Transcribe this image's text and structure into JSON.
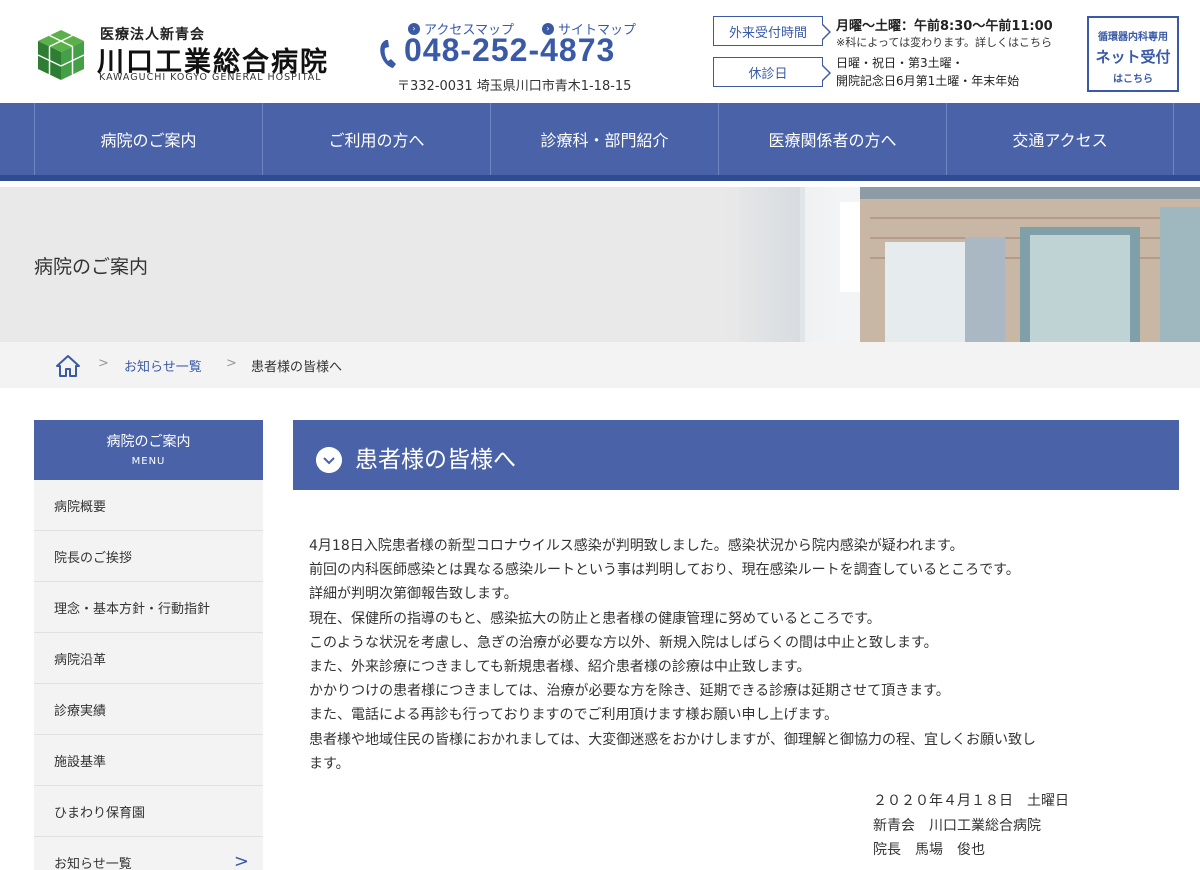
{
  "header": {
    "org": "医療法人新青会",
    "name": "川口工業総合病院",
    "name_en": "KAWAGUCHI KOGYO GENERAL HOSPITAL",
    "access_map": "アクセスマップ",
    "site_map": "サイトマップ",
    "phone": "048-252-4873",
    "address": "〒332-0031 埼玉県川口市青木1-18-15",
    "hours_label": "外来受付時間",
    "hours_main": "月曜～土曜：午前8:30～午前11:00",
    "hours_note": "※科によっては変わります。詳しくはこちら",
    "closed_label": "休診日",
    "closed_1": "日曜・祝日・第3土曜・",
    "closed_2": "開院記念日6月第1土曜・年末年始",
    "net_1": "循環器内科専用",
    "net_2": "ネット受付",
    "net_3": "はこちら"
  },
  "nav": [
    "病院のご案内",
    "ご利用の方へ",
    "診療科・部門紹介",
    "医療関係者の方へ",
    "交通アクセス"
  ],
  "hero": {
    "title": "病院のご案内"
  },
  "breadcrumb": {
    "sep": ">",
    "link": "お知らせ一覧",
    "current": "患者様の皆様へ"
  },
  "side": {
    "title": "病院のご案内",
    "subtitle": "MENU",
    "items": [
      "病院概要",
      "院長のご挨拶",
      "理念・基本方針・行動指針",
      "病院沿革",
      "診療実績",
      "施設基準",
      "ひまわり保育園",
      "お知らせ一覧"
    ],
    "chevron": ">"
  },
  "main": {
    "title": "患者様の皆様へ",
    "lines": [
      "4月18日入院患者様の新型コロナウイルス感染が判明致しました。感染状況から院内感染が疑われます。",
      "前回の内科医師感染とは異なる感染ルートという事は判明しており、現在感染ルートを調査しているところです。",
      "詳細が判明次第御報告致します。",
      "現在、保健所の指導のもと、感染拡大の防止と患者様の健康管理に努めているところです。",
      "このような状況を考慮し、急ぎの治療が必要な方以外、新規入院はしばらくの間は中止と致します。",
      "また、外来診療につきましても新規患者様、紹介患者様の診療は中止致します。",
      "かかりつけの患者様につきましては、治療が必要な方を除き、延期できる診療は延期させて頂きます。",
      "また、電話による再診も行っておりますのでご利用頂けます様お願い申し上げます。",
      "患者様や地域住民の皆様におかれましては、大変御迷惑をおかけしますが、御理解と御協力の程、宜しくお願い致し",
      "ます。"
    ],
    "date": "２０２０年４月１８日　土曜日",
    "signer_org": "新青会　川口工業総合病院",
    "signer": "院長　馬場　俊也"
  },
  "colors": {
    "brand": "#4a62a8",
    "brand_dark": "#2f4b91",
    "logo_green": "#2e8b3e"
  }
}
